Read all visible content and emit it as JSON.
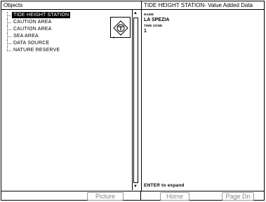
{
  "left_pane": {
    "title": "Objects",
    "items": [
      {
        "label": "TIDE HEIGHT STATION",
        "selected": true
      },
      {
        "label": "CAUTION AREA"
      },
      {
        "label": "CAUTION AREA"
      },
      {
        "label": "SEA AREA"
      },
      {
        "label": "DATA SOURCE"
      },
      {
        "label": "NATURE RESERVE"
      }
    ],
    "preview_icon": "tide-station-symbol",
    "preview_mark": "+"
  },
  "right_pane": {
    "title": "TIDE HEIGHT STATION- Value Added Data",
    "attributes": [
      {
        "name": "NAME",
        "value": "LA SPEZIA"
      },
      {
        "name": "TIME ZONE",
        "value": "1"
      }
    ],
    "hint": "ENTER to expand"
  },
  "softkeys": {
    "picture": "Picture",
    "home": "Home",
    "page_dn": "Page Dn"
  },
  "scrollbar": {
    "up_icon": "arrow-up-icon",
    "down_icon": "arrow-down-icon"
  }
}
